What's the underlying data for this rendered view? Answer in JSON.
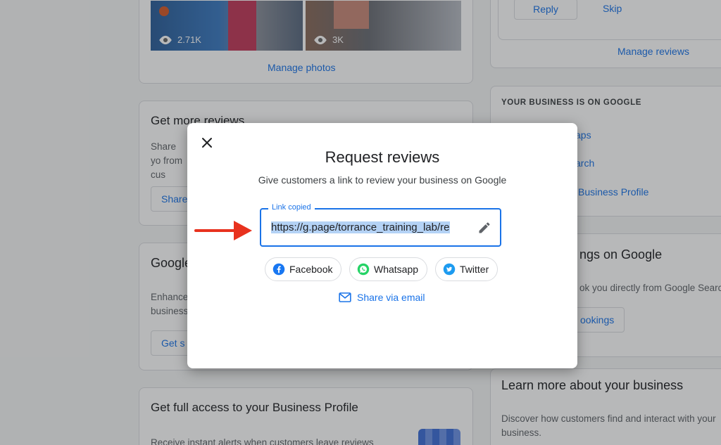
{
  "photos_card": {
    "photo1_views": "2.71K",
    "photo2_views": "3K",
    "manage_photos": "Manage photos"
  },
  "reviews_top_card": {
    "reply": "Reply",
    "skip": "Skip",
    "manage_reviews": "Manage reviews"
  },
  "get_reviews_card": {
    "title": "Get more reviews",
    "desc": "Share yo from cus",
    "button": "Share"
  },
  "google_card": {
    "title": "Google",
    "desc_line1": "Enhance",
    "desc_line2": "business",
    "button": "Get s"
  },
  "full_access_card": {
    "title": "Get full access to your Business Profile",
    "desc": "Receive instant alerts when customers leave reviews"
  },
  "on_google_card": {
    "heading": "YOUR BUSINESS IS ON GOOGLE",
    "item1": "aps",
    "item2": "arch",
    "item3": "Business Profile"
  },
  "bookings_card": {
    "title": "ngs on Google",
    "desc": "ok you directly from Google Search",
    "button": "ookings"
  },
  "learn_card": {
    "title": "Learn more about your business",
    "desc": "Discover how customers find and interact with your business."
  },
  "dialog": {
    "title": "Request reviews",
    "subtitle": "Give customers a link to review your business on Google",
    "field_label": "Link copied",
    "link_value": "https://g.page/torrance_training_lab/re",
    "share_facebook": "Facebook",
    "share_whatsapp": "Whatsapp",
    "share_twitter": "Twitter",
    "share_email": "Share via email"
  },
  "colors": {
    "accent": "#1a73e8",
    "annotation_arrow": "#e8321e",
    "facebook": "#1877f2",
    "whatsapp": "#25d366",
    "twitter": "#1d9bf0"
  },
  "icons": [
    "eye-icon",
    "close-icon",
    "edit-pencil-icon",
    "facebook-icon",
    "whatsapp-icon",
    "twitter-icon",
    "email-icon",
    "red-arrow-annotation"
  ]
}
